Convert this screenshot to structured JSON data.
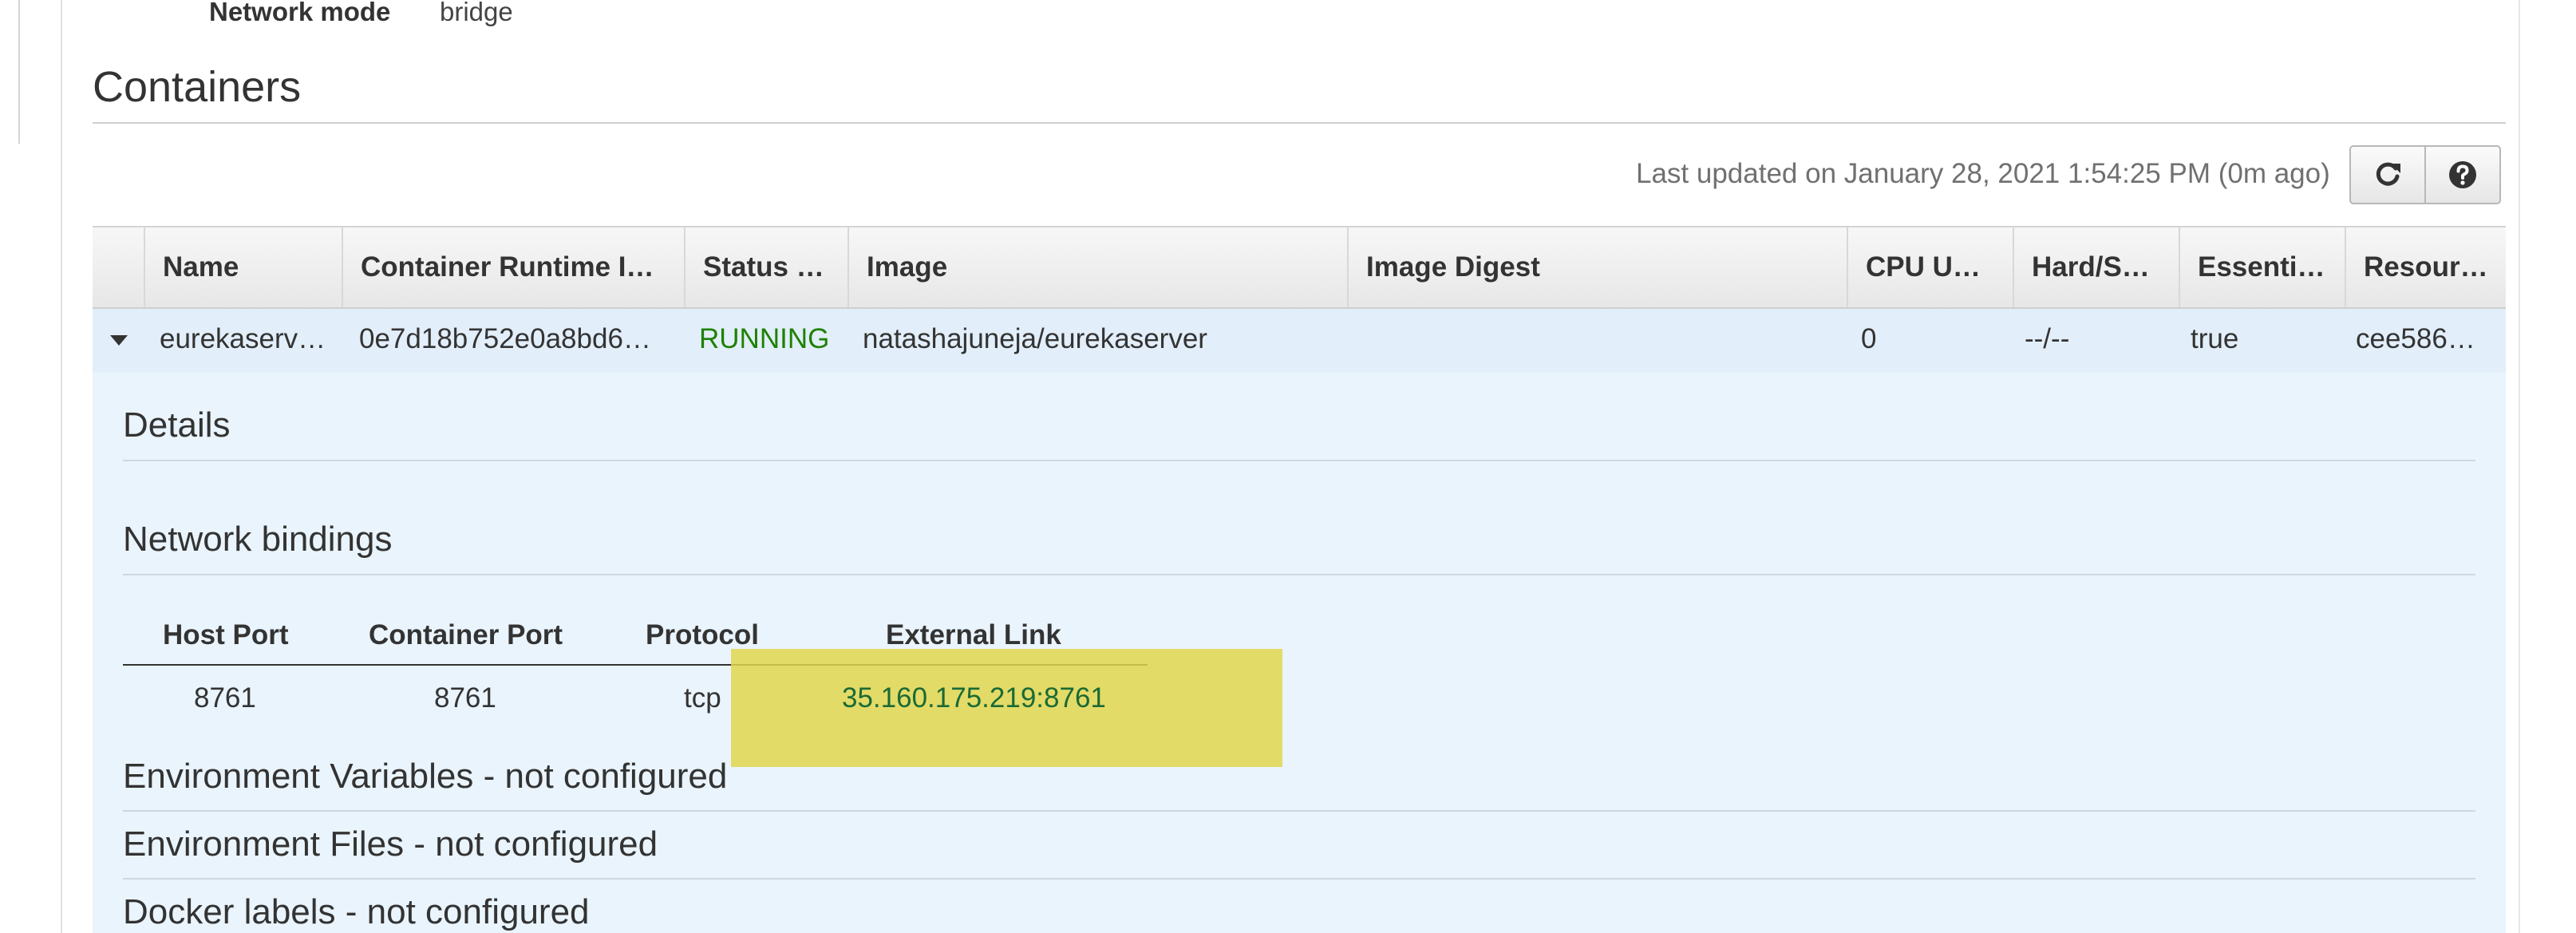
{
  "network": {
    "label": "Network mode",
    "value": "bridge"
  },
  "containers": {
    "title": "Containers",
    "last_updated": "Last updated on January 28, 2021 1:54:25 PM (0m ago)",
    "refresh_icon": "refresh-icon",
    "help_icon": "help-icon",
    "columns": [
      "Name",
      "Container Runtime I…",
      "Status …",
      "Image",
      "Image Digest",
      "CPU U…",
      "Hard/S…",
      "Essenti…",
      "Resour…"
    ],
    "row": {
      "name": "eurekaserv…",
      "runtime_id": "0e7d18b752e0a8bd6…",
      "status": "RUNNING",
      "image": "natashajuneja/eurekaserver",
      "image_digest": "",
      "cpu": "0",
      "hard_soft": "--/--",
      "essential": "true",
      "resource": "cee586…"
    }
  },
  "details": {
    "title": "Details",
    "network_bindings": {
      "title": "Network bindings",
      "columns": [
        "Host Port",
        "Container Port",
        "Protocol",
        "External Link"
      ],
      "row": {
        "host_port": "8761",
        "container_port": "8761",
        "protocol": "tcp",
        "external_link": "35.160.175.219:8761"
      }
    },
    "env_vars": "Environment Variables - not configured",
    "env_files": "Environment Files - not configured",
    "docker_labels": "Docker labels - not configured"
  },
  "colors": {
    "status_running": "#1d8102",
    "highlight": "#e1d64c",
    "expanded_row_bg": "#eaf4fc"
  }
}
